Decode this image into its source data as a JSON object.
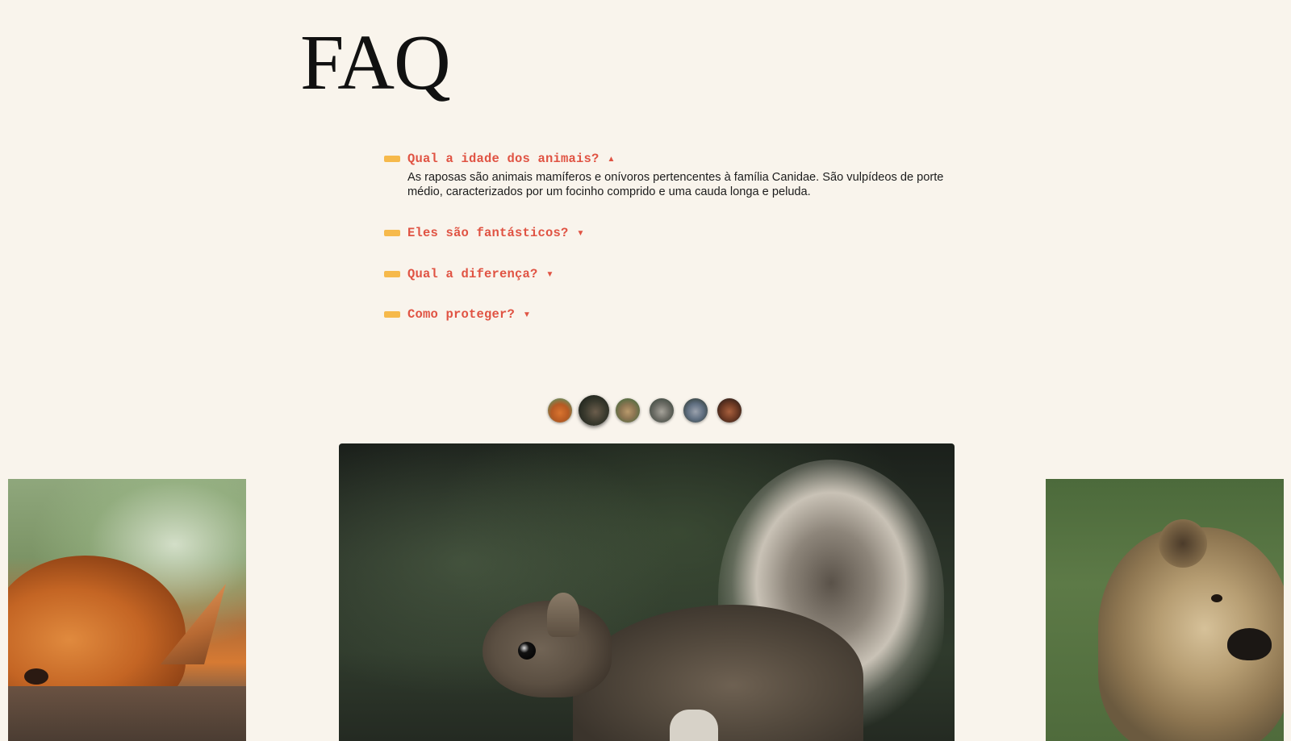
{
  "page": {
    "title": "FAQ"
  },
  "faq": {
    "items": [
      {
        "question": "Qual a idade dos animais?",
        "arrow": "▲",
        "expanded": true,
        "answer": "As raposas são animais mamíferos e onívoros pertencentes à família Canidae. São vulpídeos de porte médio, caracterizados por um focinho comprido e uma cauda longa e peluda."
      },
      {
        "question": "Eles são fantásticos?",
        "arrow": "▼",
        "expanded": false
      },
      {
        "question": "Qual a diferença?",
        "arrow": "▼",
        "expanded": false
      },
      {
        "question": "Como proteger?",
        "arrow": "▼",
        "expanded": false
      }
    ]
  },
  "carousel": {
    "thumbnails": [
      "fox",
      "squirrel",
      "bear",
      "wolf",
      "monkey",
      "orangutan"
    ],
    "active_index": 1,
    "slides": [
      "fox",
      "squirrel",
      "bear"
    ]
  },
  "colors": {
    "background": "#f9f4ec",
    "question": "#e05343",
    "marker": "#f6b94b",
    "title": "#111111"
  }
}
